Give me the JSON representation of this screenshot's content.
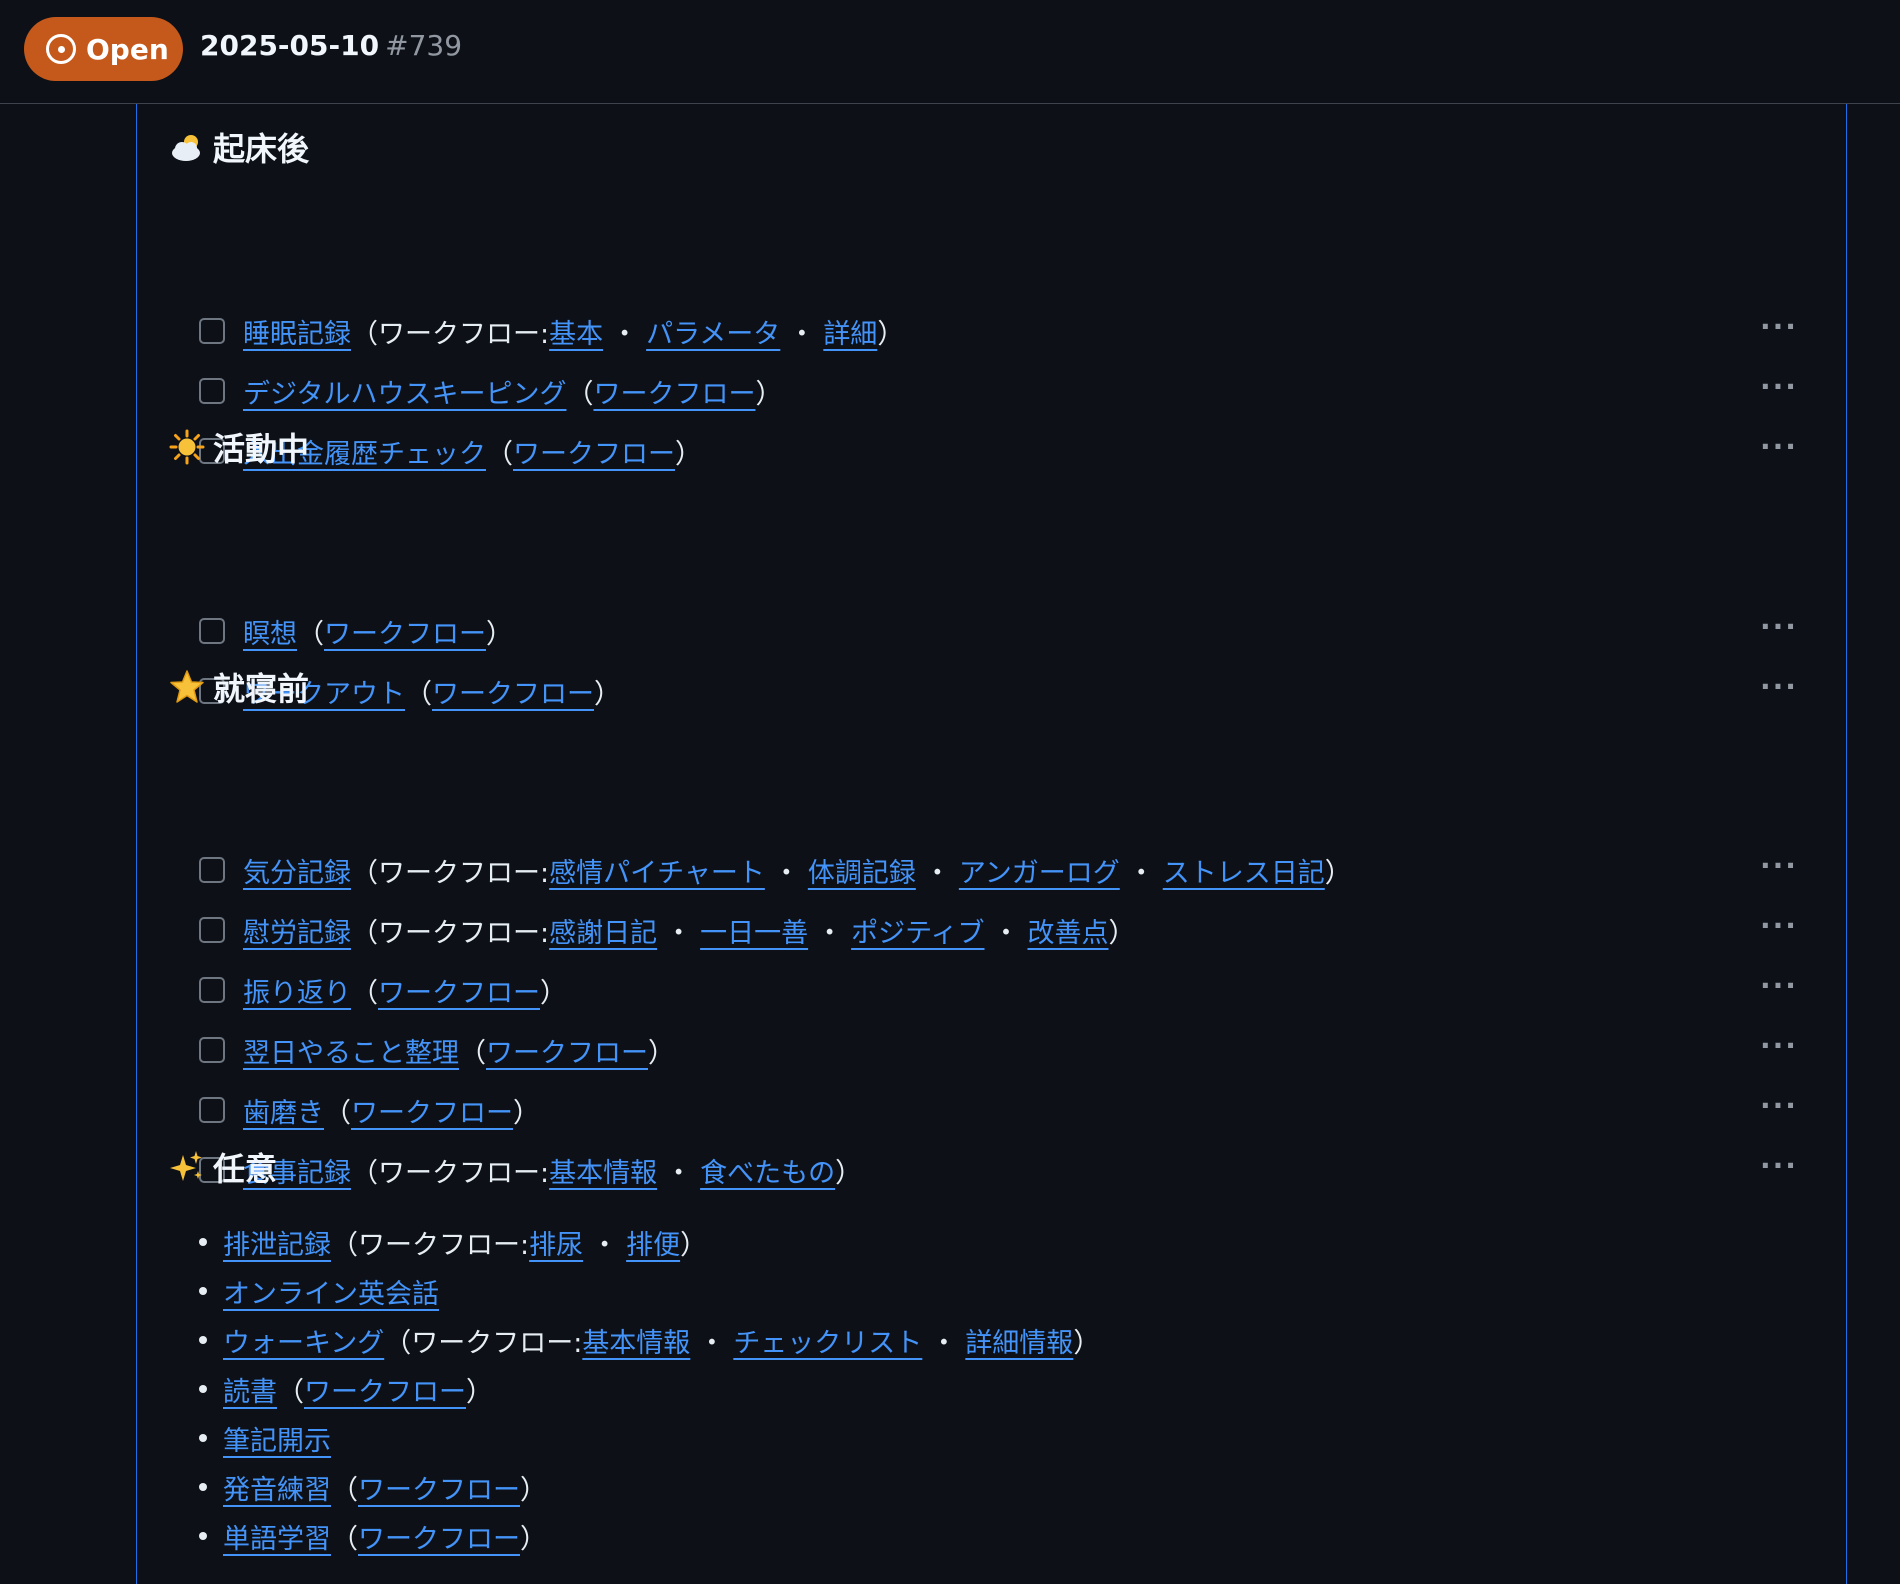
{
  "header": {
    "state": "Open",
    "title": "2025-05-10",
    "number": "#739"
  },
  "sections": {
    "wake": {
      "heading": "起床後",
      "icon": "cloud-sun-icon",
      "tasks": [
        {
          "name": "睡眠記録",
          "prefix": "（ワークフロー: ",
          "links": [
            "基本",
            "パラメータ",
            "詳細"
          ]
        },
        {
          "name": "デジタルハウスキーピング",
          "prefix": "（",
          "links": [
            "ワークフロー"
          ]
        },
        {
          "name": "入出金履歴チェック",
          "prefix": "（",
          "links": [
            "ワークフロー"
          ]
        }
      ]
    },
    "active": {
      "heading": "活動中",
      "icon": "sun-icon",
      "tasks": [
        {
          "name": "瞑想",
          "prefix": "（",
          "links": [
            "ワークフロー"
          ]
        },
        {
          "name": "ワークアウト",
          "prefix": "（",
          "links": [
            "ワークフロー"
          ]
        }
      ]
    },
    "bedtime": {
      "heading": "就寝前",
      "icon": "star-icon",
      "tasks": [
        {
          "name": "気分記録",
          "prefix": "（ワークフロー: ",
          "links": [
            "感情パイチャート",
            "体調記録",
            "アンガーログ",
            "ストレス日記"
          ]
        },
        {
          "name": "慰労記録",
          "prefix": "（ワークフロー: ",
          "links": [
            "感謝日記",
            "一日一善",
            "ポジティブ",
            "改善点"
          ]
        },
        {
          "name": "振り返り",
          "prefix": "（",
          "links": [
            "ワークフロー"
          ]
        },
        {
          "name": "翌日やること整理",
          "prefix": "（",
          "links": [
            "ワークフロー"
          ]
        },
        {
          "name": "歯磨き",
          "prefix": "（",
          "links": [
            "ワークフロー"
          ]
        },
        {
          "name": "食事記録",
          "prefix": "（ワークフロー: ",
          "links": [
            "基本情報",
            "食べたもの"
          ]
        }
      ]
    },
    "optional": {
      "heading": "任意",
      "icon": "sparkles-icon",
      "items": [
        {
          "name": "排泄記録",
          "prefix": "（ワークフロー: ",
          "links": [
            "排尿",
            "排便"
          ]
        },
        {
          "name": "オンライン英会話",
          "prefix": "",
          "links": []
        },
        {
          "name": "ウォーキング",
          "prefix": "（ワークフロー: ",
          "links": [
            "基本情報",
            "チェックリスト",
            "詳細情報"
          ]
        },
        {
          "name": "読書",
          "prefix": "（",
          "links": [
            "ワークフロー"
          ]
        },
        {
          "name": "筆記開示",
          "prefix": "",
          "links": []
        },
        {
          "name": "発音練習",
          "prefix": "（",
          "links": [
            "ワークフロー"
          ]
        },
        {
          "name": "単語学習",
          "prefix": "（",
          "links": [
            "ワークフロー"
          ]
        }
      ]
    }
  },
  "separator": "・",
  "closer": "）",
  "more_label": "···"
}
